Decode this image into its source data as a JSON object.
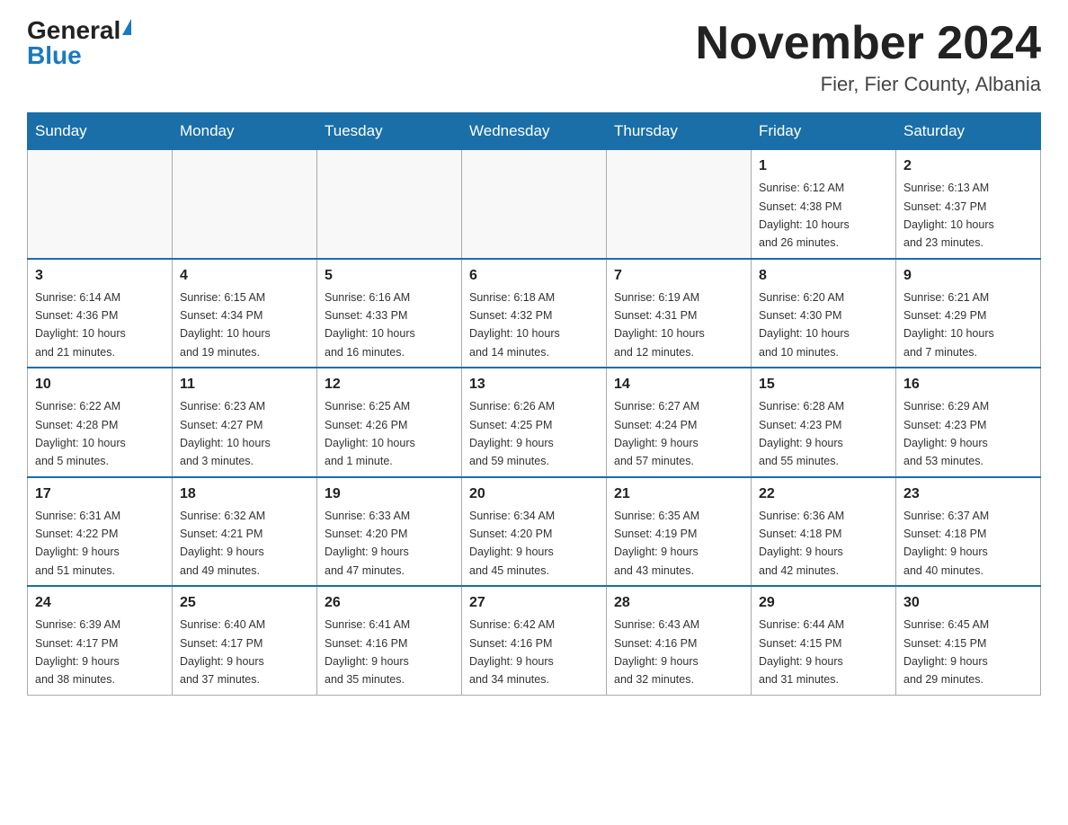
{
  "header": {
    "logo_general": "General",
    "logo_blue": "Blue",
    "month_title": "November 2024",
    "location": "Fier, Fier County, Albania"
  },
  "weekdays": [
    "Sunday",
    "Monday",
    "Tuesday",
    "Wednesday",
    "Thursday",
    "Friday",
    "Saturday"
  ],
  "weeks": [
    [
      {
        "day": "",
        "info": ""
      },
      {
        "day": "",
        "info": ""
      },
      {
        "day": "",
        "info": ""
      },
      {
        "day": "",
        "info": ""
      },
      {
        "day": "",
        "info": ""
      },
      {
        "day": "1",
        "info": "Sunrise: 6:12 AM\nSunset: 4:38 PM\nDaylight: 10 hours\nand 26 minutes."
      },
      {
        "day": "2",
        "info": "Sunrise: 6:13 AM\nSunset: 4:37 PM\nDaylight: 10 hours\nand 23 minutes."
      }
    ],
    [
      {
        "day": "3",
        "info": "Sunrise: 6:14 AM\nSunset: 4:36 PM\nDaylight: 10 hours\nand 21 minutes."
      },
      {
        "day": "4",
        "info": "Sunrise: 6:15 AM\nSunset: 4:34 PM\nDaylight: 10 hours\nand 19 minutes."
      },
      {
        "day": "5",
        "info": "Sunrise: 6:16 AM\nSunset: 4:33 PM\nDaylight: 10 hours\nand 16 minutes."
      },
      {
        "day": "6",
        "info": "Sunrise: 6:18 AM\nSunset: 4:32 PM\nDaylight: 10 hours\nand 14 minutes."
      },
      {
        "day": "7",
        "info": "Sunrise: 6:19 AM\nSunset: 4:31 PM\nDaylight: 10 hours\nand 12 minutes."
      },
      {
        "day": "8",
        "info": "Sunrise: 6:20 AM\nSunset: 4:30 PM\nDaylight: 10 hours\nand 10 minutes."
      },
      {
        "day": "9",
        "info": "Sunrise: 6:21 AM\nSunset: 4:29 PM\nDaylight: 10 hours\nand 7 minutes."
      }
    ],
    [
      {
        "day": "10",
        "info": "Sunrise: 6:22 AM\nSunset: 4:28 PM\nDaylight: 10 hours\nand 5 minutes."
      },
      {
        "day": "11",
        "info": "Sunrise: 6:23 AM\nSunset: 4:27 PM\nDaylight: 10 hours\nand 3 minutes."
      },
      {
        "day": "12",
        "info": "Sunrise: 6:25 AM\nSunset: 4:26 PM\nDaylight: 10 hours\nand 1 minute."
      },
      {
        "day": "13",
        "info": "Sunrise: 6:26 AM\nSunset: 4:25 PM\nDaylight: 9 hours\nand 59 minutes."
      },
      {
        "day": "14",
        "info": "Sunrise: 6:27 AM\nSunset: 4:24 PM\nDaylight: 9 hours\nand 57 minutes."
      },
      {
        "day": "15",
        "info": "Sunrise: 6:28 AM\nSunset: 4:23 PM\nDaylight: 9 hours\nand 55 minutes."
      },
      {
        "day": "16",
        "info": "Sunrise: 6:29 AM\nSunset: 4:23 PM\nDaylight: 9 hours\nand 53 minutes."
      }
    ],
    [
      {
        "day": "17",
        "info": "Sunrise: 6:31 AM\nSunset: 4:22 PM\nDaylight: 9 hours\nand 51 minutes."
      },
      {
        "day": "18",
        "info": "Sunrise: 6:32 AM\nSunset: 4:21 PM\nDaylight: 9 hours\nand 49 minutes."
      },
      {
        "day": "19",
        "info": "Sunrise: 6:33 AM\nSunset: 4:20 PM\nDaylight: 9 hours\nand 47 minutes."
      },
      {
        "day": "20",
        "info": "Sunrise: 6:34 AM\nSunset: 4:20 PM\nDaylight: 9 hours\nand 45 minutes."
      },
      {
        "day": "21",
        "info": "Sunrise: 6:35 AM\nSunset: 4:19 PM\nDaylight: 9 hours\nand 43 minutes."
      },
      {
        "day": "22",
        "info": "Sunrise: 6:36 AM\nSunset: 4:18 PM\nDaylight: 9 hours\nand 42 minutes."
      },
      {
        "day": "23",
        "info": "Sunrise: 6:37 AM\nSunset: 4:18 PM\nDaylight: 9 hours\nand 40 minutes."
      }
    ],
    [
      {
        "day": "24",
        "info": "Sunrise: 6:39 AM\nSunset: 4:17 PM\nDaylight: 9 hours\nand 38 minutes."
      },
      {
        "day": "25",
        "info": "Sunrise: 6:40 AM\nSunset: 4:17 PM\nDaylight: 9 hours\nand 37 minutes."
      },
      {
        "day": "26",
        "info": "Sunrise: 6:41 AM\nSunset: 4:16 PM\nDaylight: 9 hours\nand 35 minutes."
      },
      {
        "day": "27",
        "info": "Sunrise: 6:42 AM\nSunset: 4:16 PM\nDaylight: 9 hours\nand 34 minutes."
      },
      {
        "day": "28",
        "info": "Sunrise: 6:43 AM\nSunset: 4:16 PM\nDaylight: 9 hours\nand 32 minutes."
      },
      {
        "day": "29",
        "info": "Sunrise: 6:44 AM\nSunset: 4:15 PM\nDaylight: 9 hours\nand 31 minutes."
      },
      {
        "day": "30",
        "info": "Sunrise: 6:45 AM\nSunset: 4:15 PM\nDaylight: 9 hours\nand 29 minutes."
      }
    ]
  ]
}
